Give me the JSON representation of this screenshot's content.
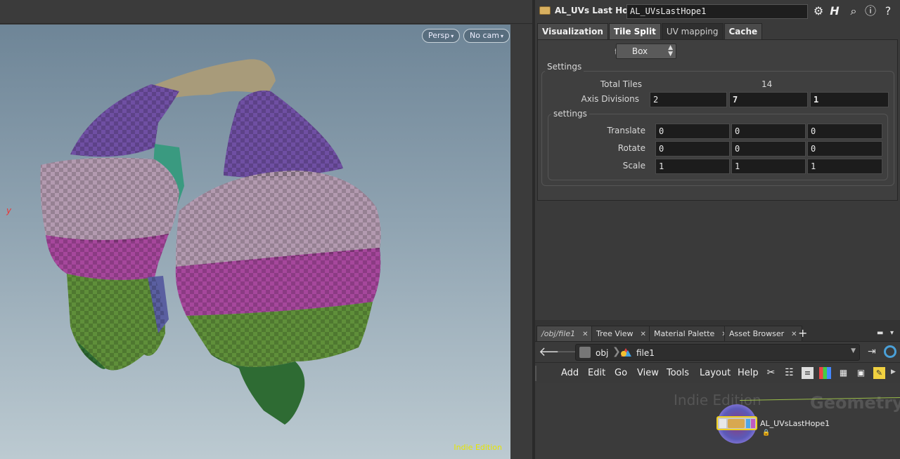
{
  "viewport": {
    "camera_persp": "Persp",
    "camera_nocam": "No cam",
    "edition_badge": "Indie Edition",
    "axis_label": "y"
  },
  "params": {
    "node_type_label": "AL_UVs Last Hope",
    "node_name": "AL_UVsLastHope1",
    "tabs": [
      "Visualization",
      "Tile Split",
      "UV mapping",
      "Cache"
    ],
    "type_label": "type",
    "type_value": "Box",
    "settings_title": "Settings",
    "total_tiles_label": "Total Tiles",
    "total_tiles_value": "14",
    "axis_divisions_label": "Axis Divisions",
    "axis_divisions": [
      "2",
      "7",
      "1"
    ],
    "sub_settings_title": "settings",
    "translate_label": "Translate",
    "translate": [
      "0",
      "0",
      "0"
    ],
    "rotate_label": "Rotate",
    "rotate": [
      "0",
      "0",
      "0"
    ],
    "scale_label": "Scale",
    "scale": [
      "1",
      "1",
      "1"
    ]
  },
  "network": {
    "tabs": [
      "/obj/file1",
      "Tree View",
      "Material Palette",
      "Asset Browser"
    ],
    "path_obj": "obj",
    "path_file": "file1",
    "menu": [
      "Add",
      "Edit",
      "Go",
      "View",
      "Tools",
      "Layout",
      "Help"
    ],
    "watermark_indie": "Indie Edition",
    "watermark_context": "Geometry",
    "node_name": "AL_UVsLastHope1"
  }
}
